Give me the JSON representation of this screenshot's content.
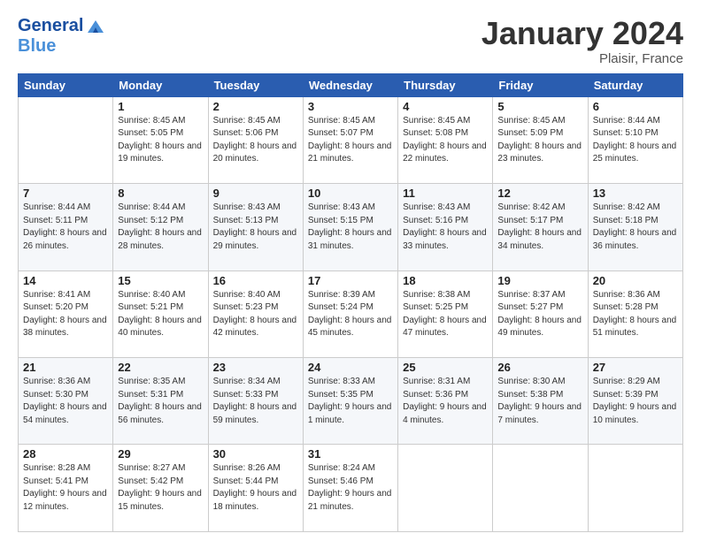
{
  "logo": {
    "general": "General",
    "blue": "Blue"
  },
  "title": "January 2024",
  "subtitle": "Plaisir, France",
  "columns": [
    "Sunday",
    "Monday",
    "Tuesday",
    "Wednesday",
    "Thursday",
    "Friday",
    "Saturday"
  ],
  "weeks": [
    [
      {
        "day": "",
        "sunrise": "",
        "sunset": "",
        "daylight": ""
      },
      {
        "day": "1",
        "sunrise": "Sunrise: 8:45 AM",
        "sunset": "Sunset: 5:05 PM",
        "daylight": "Daylight: 8 hours and 19 minutes."
      },
      {
        "day": "2",
        "sunrise": "Sunrise: 8:45 AM",
        "sunset": "Sunset: 5:06 PM",
        "daylight": "Daylight: 8 hours and 20 minutes."
      },
      {
        "day": "3",
        "sunrise": "Sunrise: 8:45 AM",
        "sunset": "Sunset: 5:07 PM",
        "daylight": "Daylight: 8 hours and 21 minutes."
      },
      {
        "day": "4",
        "sunrise": "Sunrise: 8:45 AM",
        "sunset": "Sunset: 5:08 PM",
        "daylight": "Daylight: 8 hours and 22 minutes."
      },
      {
        "day": "5",
        "sunrise": "Sunrise: 8:45 AM",
        "sunset": "Sunset: 5:09 PM",
        "daylight": "Daylight: 8 hours and 23 minutes."
      },
      {
        "day": "6",
        "sunrise": "Sunrise: 8:44 AM",
        "sunset": "Sunset: 5:10 PM",
        "daylight": "Daylight: 8 hours and 25 minutes."
      }
    ],
    [
      {
        "day": "7",
        "sunrise": "Sunrise: 8:44 AM",
        "sunset": "Sunset: 5:11 PM",
        "daylight": "Daylight: 8 hours and 26 minutes."
      },
      {
        "day": "8",
        "sunrise": "Sunrise: 8:44 AM",
        "sunset": "Sunset: 5:12 PM",
        "daylight": "Daylight: 8 hours and 28 minutes."
      },
      {
        "day": "9",
        "sunrise": "Sunrise: 8:43 AM",
        "sunset": "Sunset: 5:13 PM",
        "daylight": "Daylight: 8 hours and 29 minutes."
      },
      {
        "day": "10",
        "sunrise": "Sunrise: 8:43 AM",
        "sunset": "Sunset: 5:15 PM",
        "daylight": "Daylight: 8 hours and 31 minutes."
      },
      {
        "day": "11",
        "sunrise": "Sunrise: 8:43 AM",
        "sunset": "Sunset: 5:16 PM",
        "daylight": "Daylight: 8 hours and 33 minutes."
      },
      {
        "day": "12",
        "sunrise": "Sunrise: 8:42 AM",
        "sunset": "Sunset: 5:17 PM",
        "daylight": "Daylight: 8 hours and 34 minutes."
      },
      {
        "day": "13",
        "sunrise": "Sunrise: 8:42 AM",
        "sunset": "Sunset: 5:18 PM",
        "daylight": "Daylight: 8 hours and 36 minutes."
      }
    ],
    [
      {
        "day": "14",
        "sunrise": "Sunrise: 8:41 AM",
        "sunset": "Sunset: 5:20 PM",
        "daylight": "Daylight: 8 hours and 38 minutes."
      },
      {
        "day": "15",
        "sunrise": "Sunrise: 8:40 AM",
        "sunset": "Sunset: 5:21 PM",
        "daylight": "Daylight: 8 hours and 40 minutes."
      },
      {
        "day": "16",
        "sunrise": "Sunrise: 8:40 AM",
        "sunset": "Sunset: 5:23 PM",
        "daylight": "Daylight: 8 hours and 42 minutes."
      },
      {
        "day": "17",
        "sunrise": "Sunrise: 8:39 AM",
        "sunset": "Sunset: 5:24 PM",
        "daylight": "Daylight: 8 hours and 45 minutes."
      },
      {
        "day": "18",
        "sunrise": "Sunrise: 8:38 AM",
        "sunset": "Sunset: 5:25 PM",
        "daylight": "Daylight: 8 hours and 47 minutes."
      },
      {
        "day": "19",
        "sunrise": "Sunrise: 8:37 AM",
        "sunset": "Sunset: 5:27 PM",
        "daylight": "Daylight: 8 hours and 49 minutes."
      },
      {
        "day": "20",
        "sunrise": "Sunrise: 8:36 AM",
        "sunset": "Sunset: 5:28 PM",
        "daylight": "Daylight: 8 hours and 51 minutes."
      }
    ],
    [
      {
        "day": "21",
        "sunrise": "Sunrise: 8:36 AM",
        "sunset": "Sunset: 5:30 PM",
        "daylight": "Daylight: 8 hours and 54 minutes."
      },
      {
        "day": "22",
        "sunrise": "Sunrise: 8:35 AM",
        "sunset": "Sunset: 5:31 PM",
        "daylight": "Daylight: 8 hours and 56 minutes."
      },
      {
        "day": "23",
        "sunrise": "Sunrise: 8:34 AM",
        "sunset": "Sunset: 5:33 PM",
        "daylight": "Daylight: 8 hours and 59 minutes."
      },
      {
        "day": "24",
        "sunrise": "Sunrise: 8:33 AM",
        "sunset": "Sunset: 5:35 PM",
        "daylight": "Daylight: 9 hours and 1 minute."
      },
      {
        "day": "25",
        "sunrise": "Sunrise: 8:31 AM",
        "sunset": "Sunset: 5:36 PM",
        "daylight": "Daylight: 9 hours and 4 minutes."
      },
      {
        "day": "26",
        "sunrise": "Sunrise: 8:30 AM",
        "sunset": "Sunset: 5:38 PM",
        "daylight": "Daylight: 9 hours and 7 minutes."
      },
      {
        "day": "27",
        "sunrise": "Sunrise: 8:29 AM",
        "sunset": "Sunset: 5:39 PM",
        "daylight": "Daylight: 9 hours and 10 minutes."
      }
    ],
    [
      {
        "day": "28",
        "sunrise": "Sunrise: 8:28 AM",
        "sunset": "Sunset: 5:41 PM",
        "daylight": "Daylight: 9 hours and 12 minutes."
      },
      {
        "day": "29",
        "sunrise": "Sunrise: 8:27 AM",
        "sunset": "Sunset: 5:42 PM",
        "daylight": "Daylight: 9 hours and 15 minutes."
      },
      {
        "day": "30",
        "sunrise": "Sunrise: 8:26 AM",
        "sunset": "Sunset: 5:44 PM",
        "daylight": "Daylight: 9 hours and 18 minutes."
      },
      {
        "day": "31",
        "sunrise": "Sunrise: 8:24 AM",
        "sunset": "Sunset: 5:46 PM",
        "daylight": "Daylight: 9 hours and 21 minutes."
      },
      {
        "day": "",
        "sunrise": "",
        "sunset": "",
        "daylight": ""
      },
      {
        "day": "",
        "sunrise": "",
        "sunset": "",
        "daylight": ""
      },
      {
        "day": "",
        "sunrise": "",
        "sunset": "",
        "daylight": ""
      }
    ]
  ]
}
